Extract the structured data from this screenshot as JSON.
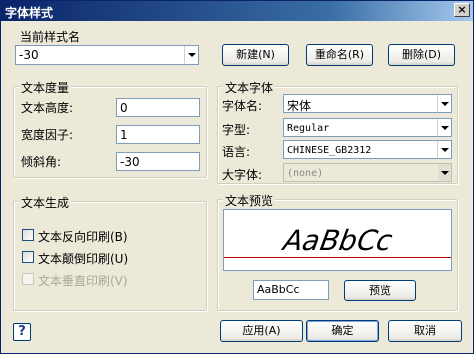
{
  "window": {
    "title": "字体样式",
    "close_label": "×"
  },
  "current_style": {
    "label": "当前样式名",
    "value": "-30",
    "buttons": {
      "new": "新建(N)",
      "rename": "重命名(R)",
      "delete": "删除(D)"
    }
  },
  "metrics": {
    "title": "文本度量",
    "height_label": "文本高度:",
    "height_value": "0",
    "width_factor_label": "宽度因子:",
    "width_factor_value": "1",
    "oblique_label": "倾斜角:",
    "oblique_value": "-30"
  },
  "font": {
    "title": "文本字体",
    "font_name_label": "字体名:",
    "font_name_value": "宋体",
    "style_label": "字型:",
    "style_value": "Regular",
    "language_label": "语言:",
    "language_value": "CHINESE_GB2312",
    "bigfont_label": "大字体:",
    "bigfont_value": "(none)"
  },
  "generation": {
    "title": "文本生成",
    "backwards": {
      "label": "文本反向印刷(B)",
      "checked": false
    },
    "upside_down": {
      "label": "文本颠倒印刷(U)",
      "checked": false
    },
    "vertical": {
      "label": "文本垂直印刷(V)",
      "checked": false,
      "disabled": true
    }
  },
  "preview": {
    "title": "文本预览",
    "sample_text": "AaBbCc",
    "input_value": "AaBbCc",
    "button_label": "预览"
  },
  "footer": {
    "help_label": "?",
    "apply": "应用(A)",
    "ok": "确定",
    "cancel": "取消"
  }
}
